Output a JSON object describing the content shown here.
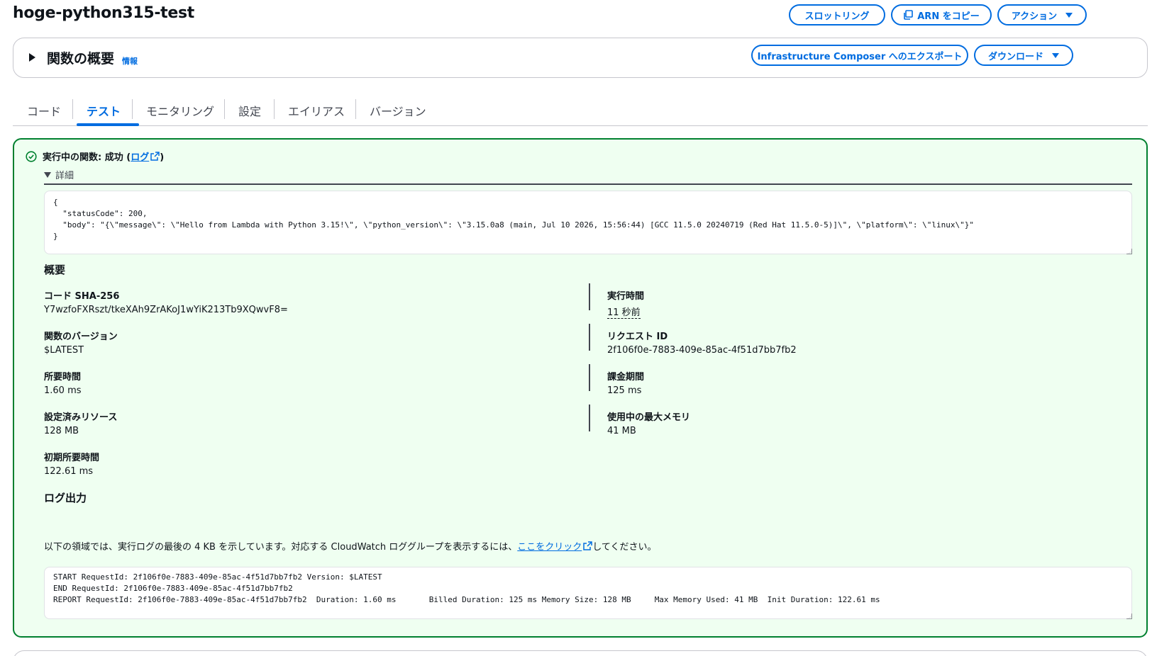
{
  "page": {
    "title": "hoge-python315-test"
  },
  "header_buttons": {
    "throttle": "スロットリング",
    "copy_arn": "ARN をコピー",
    "actions": "アクション",
    "export": "Infrastructure Composer へのエクスポート",
    "download": "ダウンロード"
  },
  "overview": {
    "heading": "関数の概要",
    "info": "情報"
  },
  "tabs": [
    {
      "label": "コード"
    },
    {
      "label": "テスト"
    },
    {
      "label": "モニタリング"
    },
    {
      "label": "設定"
    },
    {
      "label": "エイリアス"
    },
    {
      "label": "バージョン"
    }
  ],
  "result": {
    "status_prefix": "実行中の関数: 成功 (",
    "log_link": "ログ",
    "status_suffix": ")",
    "details_label": "詳細",
    "response": "{\n  \"statusCode\": 200,\n  \"body\": \"{\\\"message\\\": \\\"Hello from Lambda with Python 3.15!\\\", \\\"python_version\\\": \\\"3.15.0a8 (main, Jul 10 2026, 15:56:44) [GCC 11.5.0 20240719 (Red Hat 11.5.0-5)]\\\", \\\"platform\\\": \\\"linux\\\"}\"\n}",
    "summary_heading": "概要",
    "summary": {
      "code_sha_label": "コード SHA-256",
      "code_sha_value": "Y7wzfoFXRszt/tkeXAh9ZrAKoJ1wYiK213Tb9XQwvF8=",
      "exec_time_label": "実行時間",
      "exec_time_value": "11 秒前",
      "version_label": "関数のバージョン",
      "version_value": "$LATEST",
      "request_id_label": "リクエスト ID",
      "request_id_value": "2f106f0e-7883-409e-85ac-4f51d7bb7fb2",
      "duration_label": "所要時間",
      "duration_value": "1.60 ms",
      "billed_label": "課金期間",
      "billed_value": "125 ms",
      "resources_label": "設定済みリソース",
      "resources_value": "128 MB",
      "max_memory_label": "使用中の最大メモリ",
      "max_memory_value": "41 MB",
      "init_label": "初期所要時間",
      "init_value": "122.61 ms"
    },
    "log_heading": "ログ出力",
    "log_desc_prefix": "以下の領域では、実行ログの最後の 4 KB を示しています。対応する CloudWatch ロググループを表示するには、",
    "log_desc_link": "ここをクリック",
    "log_desc_suffix": "してください。",
    "log_output": "START RequestId: 2f106f0e-7883-409e-85ac-4f51d7bb7fb2 Version: $LATEST\nEND RequestId: 2f106f0e-7883-409e-85ac-4f51d7bb7fb2\nREPORT RequestId: 2f106f0e-7883-409e-85ac-4f51d7bb7fb2  Duration: 1.60 ms       Billed Duration: 125 ms Memory Size: 128 MB     Max Memory Used: 41 MB  Init Duration: 122.61 ms"
  },
  "colors": {
    "accent": "#006ce0",
    "success_border": "#00802f",
    "success_bg": "#effff1",
    "text": "#0f141a"
  },
  "icons": {
    "copy": "copy-icon",
    "caret": "caret-down-icon",
    "success": "check-circle-icon",
    "external": "external-link-icon",
    "expand": "triangle-right-icon"
  }
}
